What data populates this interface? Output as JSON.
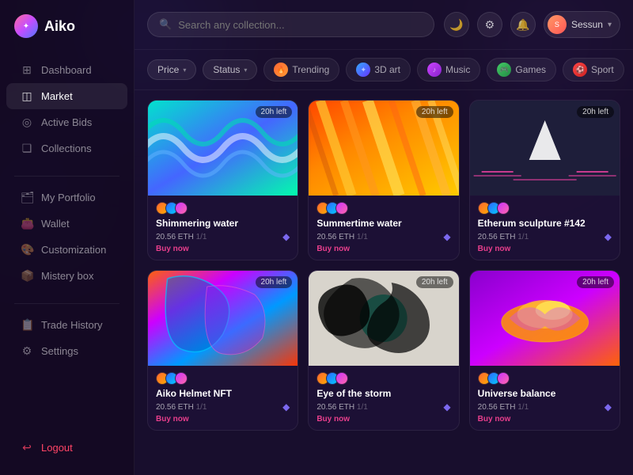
{
  "app": {
    "name": "Aiko"
  },
  "sidebar": {
    "items": [
      {
        "id": "dashboard",
        "label": "Dashboard",
        "icon": "⊞",
        "active": false
      },
      {
        "id": "market",
        "label": "Market",
        "icon": "◫",
        "active": true
      },
      {
        "id": "active-bids",
        "label": "Active Bids",
        "icon": "◎",
        "active": false
      },
      {
        "id": "collections",
        "label": "Collections",
        "icon": "❏",
        "active": false
      }
    ],
    "items2": [
      {
        "id": "my-portfolio",
        "label": "My Portfolio",
        "icon": "◻",
        "active": false
      },
      {
        "id": "wallet",
        "label": "Wallet",
        "icon": "◻",
        "active": false
      },
      {
        "id": "customization",
        "label": "Customization",
        "icon": "◻",
        "active": false
      },
      {
        "id": "mistery-box",
        "label": "Mistery box",
        "icon": "◻",
        "active": false
      }
    ],
    "items3": [
      {
        "id": "trade-history",
        "label": "Trade History",
        "icon": "◻",
        "active": false
      },
      {
        "id": "settings",
        "label": "Settings",
        "icon": "◻",
        "active": false
      }
    ],
    "logout": "Logout"
  },
  "header": {
    "search_placeholder": "Search any collection...",
    "user": {
      "name": "Sessun",
      "avatar_initials": "S"
    }
  },
  "filters": {
    "price_label": "Price",
    "status_label": "Status",
    "categories": [
      {
        "id": "trending",
        "label": "Trending",
        "color": "#ff6633"
      },
      {
        "id": "3dart",
        "label": "3D art",
        "color": "#33aaff"
      },
      {
        "id": "music",
        "label": "Music",
        "color": "#cc44ff"
      },
      {
        "id": "games",
        "label": "Games",
        "color": "#44cc66"
      },
      {
        "id": "sport",
        "label": "Sport",
        "color": "#ff4444"
      }
    ]
  },
  "nfts": [
    {
      "id": 1,
      "title": "Shimmering water",
      "price": "20.56 ETH",
      "edition": "1/1",
      "time_left": "20h left",
      "buy_now": "Buy now",
      "style": "shimmering"
    },
    {
      "id": 2,
      "title": "Summertime water",
      "price": "20.56 ETH",
      "edition": "1/1",
      "time_left": "20h left",
      "buy_now": "Buy now",
      "style": "summertime"
    },
    {
      "id": 3,
      "title": "Etherum sculpture #142",
      "price": "20.56 ETH",
      "edition": "1/1",
      "time_left": "20h left",
      "buy_now": "Buy now",
      "style": "ethereum"
    },
    {
      "id": 4,
      "title": "Aiko Helmet NFT",
      "price": "20.56 ETH",
      "edition": "1/1",
      "time_left": "20h left",
      "buy_now": "Buy now",
      "style": "helmet"
    },
    {
      "id": 5,
      "title": "Eye of the storm",
      "price": "20.56 ETH",
      "edition": "1/1",
      "time_left": "20h left",
      "buy_now": "Buy now",
      "style": "storm"
    },
    {
      "id": 6,
      "title": "Universe balance",
      "price": "20.56 ETH",
      "edition": "1/1",
      "time_left": "20h left",
      "buy_now": "Buy now",
      "style": "universe"
    }
  ]
}
